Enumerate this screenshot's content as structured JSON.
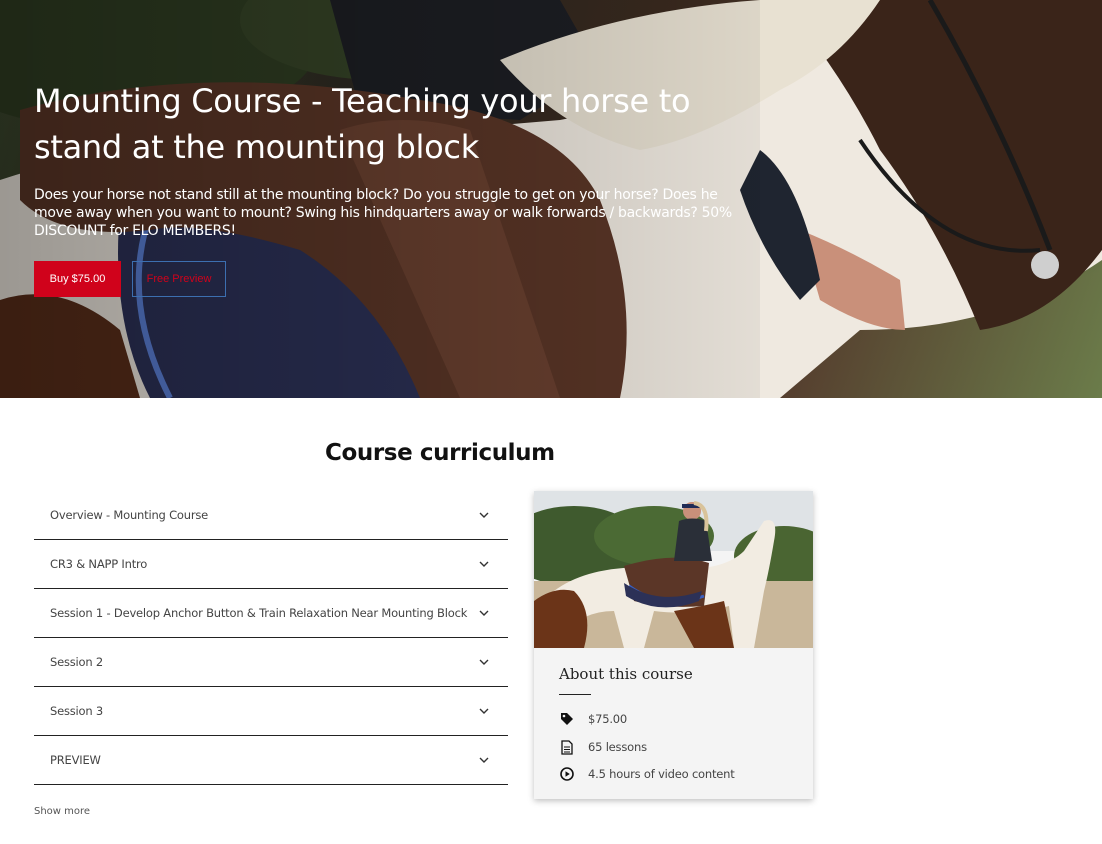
{
  "hero": {
    "title": "Mounting Course - Teaching your horse to stand at the mounting block",
    "description": "Does your horse not stand still at the mounting block? Do you struggle to get on your horse? Does he move away when you want to mount? Swing his hindquarters away or walk forwards / backwards? 50% DISCOUNT for ELO MEMBERS!",
    "buy_label": "Buy $75.00",
    "preview_label": "Free Preview"
  },
  "curriculum": {
    "title": "Course curriculum",
    "sections": [
      {
        "label": "Overview - Mounting Course"
      },
      {
        "label": "CR3 & NAPP Intro"
      },
      {
        "label": "Session 1 - Develop Anchor Button & Train Relaxation Near Mounting Block"
      },
      {
        "label": "Session 2"
      },
      {
        "label": "Session 3"
      },
      {
        "label": "PREVIEW"
      }
    ],
    "show_more": "Show more"
  },
  "about": {
    "title": "About this course",
    "price": "$75.00",
    "lessons": "65 lessons",
    "video": "4.5 hours of video content"
  },
  "colors": {
    "accent": "#d0021b",
    "preview_border": "#3c6fb0"
  }
}
